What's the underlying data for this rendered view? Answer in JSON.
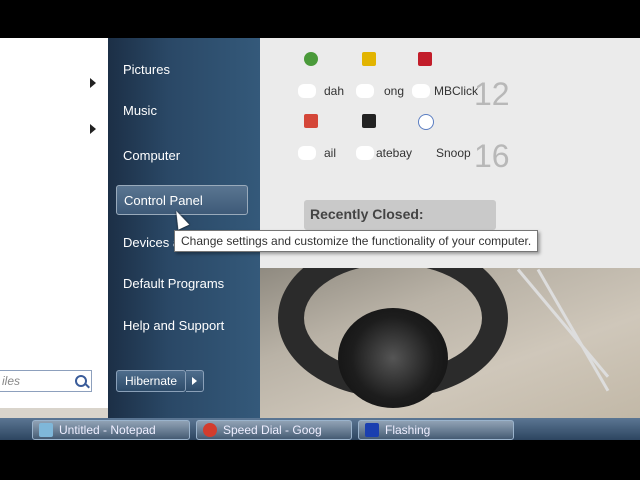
{
  "start_menu": {
    "items": [
      {
        "label": "Pictures"
      },
      {
        "label": "Music"
      },
      {
        "label": "Computer"
      },
      {
        "label": "Control Panel"
      },
      {
        "label": "Devices a"
      },
      {
        "label": "Default Programs"
      },
      {
        "label": "Help and Support"
      }
    ],
    "hovered_index": 3,
    "search_placeholder": "iles",
    "shutdown_label": "Hibernate"
  },
  "tooltip": {
    "text": "Change settings and customize the functionality of your computer."
  },
  "speed_dial": {
    "items": [
      {
        "label": "dah",
        "icon": "site-icon-green",
        "color": "#4a9a3a"
      },
      {
        "label": "ong",
        "icon": "site-icon-yellow",
        "color": "#e2b400"
      },
      {
        "label": "MBClick",
        "icon": "site-icon-red",
        "color": "#c21d2a"
      },
      {
        "label": "ail",
        "icon": "gmail-icon",
        "color": "#d44638"
      },
      {
        "label": "atebay",
        "icon": "piratebay-icon",
        "color": "#222222"
      },
      {
        "label": "Snoop",
        "icon": "snoop-icon",
        "color": "#5b7ec2"
      }
    ],
    "numbers": [
      "12",
      "16"
    ],
    "recently_closed": "Recently Closed:"
  },
  "taskbar": {
    "buttons": [
      {
        "label": "Untitled - Notepad",
        "icon": "notepad-icon",
        "color": "#7fb7d9"
      },
      {
        "label": "Speed Dial - Goog",
        "icon": "chrome-icon",
        "color": "#d33c2d"
      },
      {
        "label": "Flashing",
        "icon": "flashing-icon",
        "color": "#1a3fb0"
      }
    ]
  }
}
